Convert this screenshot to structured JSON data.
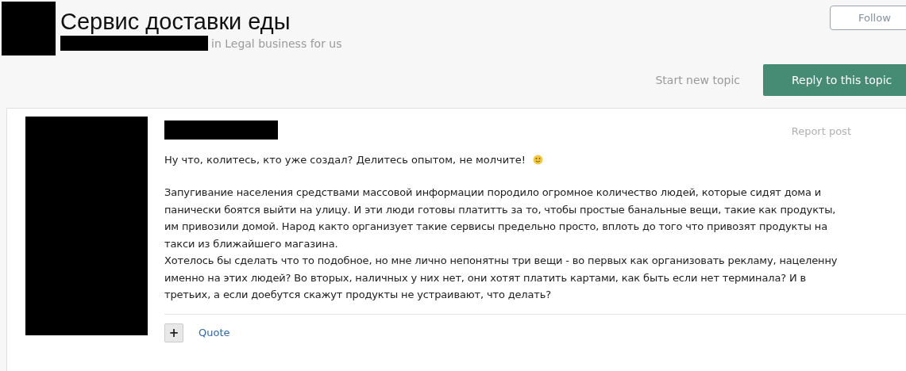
{
  "topic": {
    "title": "Сервис доставки еды",
    "forum_note": "in Legal business for us"
  },
  "follow_button": {
    "label": "Follow"
  },
  "actions": {
    "start_topic": "Start new topic",
    "reply": "Reply to this topic"
  },
  "post": {
    "report": "Report post",
    "paragraphs": [
      "Ну что, колитесь, кто уже создал? Делитесь опытом, не молчите!",
      "Запугивание населения средствами массовой информации породило огромное количество людей, которые сидят дома и\nпанически боятся выйти на улицу. И эти люди готовы платитть за то, чтобы простые банальные вещи, такие как продукты,\nим привозили домой. Народ както организует такие сервисы предельно просто, вплоть до того что привозят продукты на\nтакси из ближайшего магазина.\nХотелось бы сделать что то подобное, но мне лично непонятны три вещи - во первых как организовать рекламу, нацеленну\nименно на этих людей? Во вторых, наличных у них нет, они хотят платить картами, как быть если нет терминала? И в\nтретьих, а если доебутся скажут продукты не устраивают, что делать?"
    ],
    "plus": "+",
    "quote": "Quote"
  }
}
